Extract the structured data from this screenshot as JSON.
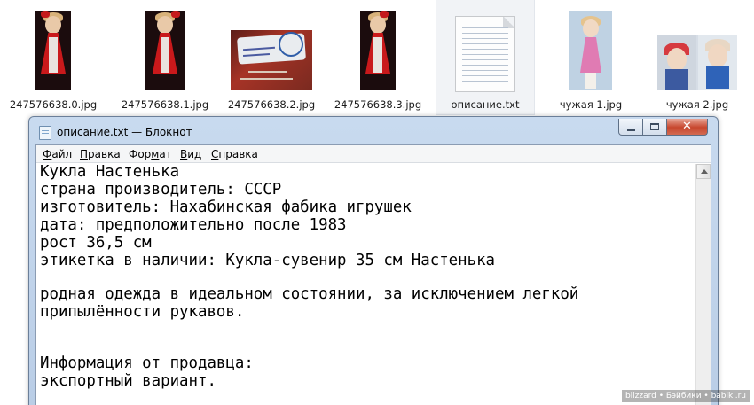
{
  "desktop": {
    "files": [
      {
        "name": "247576638.0.jpg",
        "icon": "doll-photo-icon"
      },
      {
        "name": "247576638.1.jpg",
        "icon": "doll-photo-icon"
      },
      {
        "name": "247576638.2.jpg",
        "icon": "label-photo-icon"
      },
      {
        "name": "247576638.3.jpg",
        "icon": "doll-photo-icon"
      },
      {
        "name": "описание.txt",
        "icon": "text-file-icon",
        "selected": true
      },
      {
        "name": "чужая 1.jpg",
        "icon": "doll-photo-icon"
      },
      {
        "name": "чужая 2.jpg",
        "icon": "doll-photo-icon"
      }
    ]
  },
  "window": {
    "title": "описание.txt — Блокнот",
    "menu": [
      {
        "label": "Файл",
        "hotkey_index": 0
      },
      {
        "label": "Правка",
        "hotkey_index": 0
      },
      {
        "label": "Формат",
        "hotkey_index": 3
      },
      {
        "label": "Вид",
        "hotkey_index": 0
      },
      {
        "label": "Справка",
        "hotkey_index": 0
      }
    ],
    "controls": {
      "minimize": "minimize-icon",
      "maximize": "maximize-icon",
      "close": "close-icon",
      "close_glyph": "✕"
    },
    "lines": [
      "Кукла Настенька",
      "страна производитель: СССР",
      "изготовитель: Нахабинская фабика игрушек",
      "дата: предположительно после 1983",
      "рост 36,5 см",
      "этикетка в наличии: Кукла-сувенир 35 см Настенька",
      "",
      "родная одежда в идеальном состоянии, за исключением легкой",
      "припылённости рукавов.",
      "",
      "",
      "Информация от продавца:",
      "экспортный вариант."
    ]
  },
  "watermark": "blizzard • Бэйбики • babiki.ru",
  "colors": {
    "titlebar": "#c8daef",
    "close_button": "#c7462d",
    "selection": "#f1f3f6"
  }
}
